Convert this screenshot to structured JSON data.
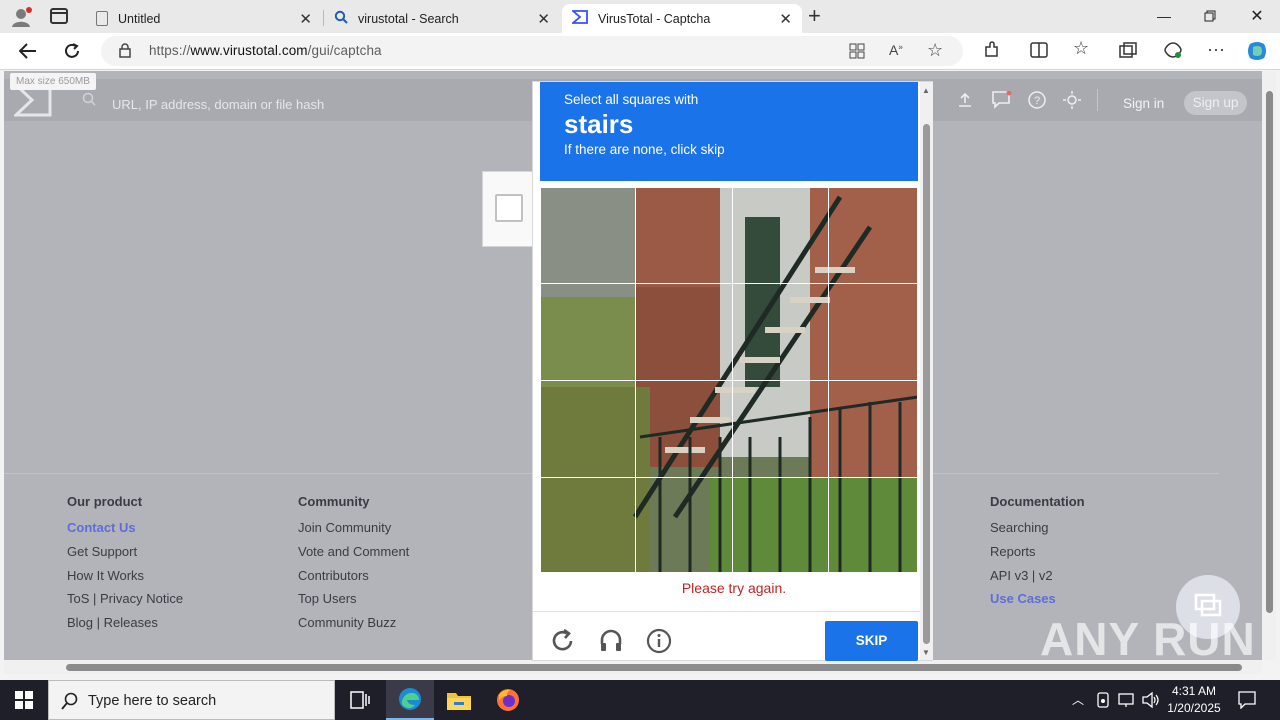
{
  "browser": {
    "tabs": [
      {
        "label": "Untitled",
        "active": false
      },
      {
        "label": "virustotal - Search",
        "active": false
      },
      {
        "label": "VirusTotal - Captcha",
        "active": true
      }
    ],
    "url_prefix": "https://",
    "url_domain": "www.virustotal.com",
    "url_path": "/gui/captcha"
  },
  "vt": {
    "max_size": "Max size 650MB",
    "search_placeholder": "URL, IP address, domain or file hash",
    "sign_in": "Sign in",
    "sign_up": "Sign up",
    "footer": {
      "col1": {
        "title": "Our product",
        "links": [
          "Contact Us",
          "Get Support",
          "How It Works",
          "ToS | Privacy Notice",
          "Blog | Releases"
        ]
      },
      "col2": {
        "title": "Community",
        "links": [
          "Join Community",
          "Vote and Comment",
          "Contributors",
          "Top Users",
          "Community Buzz"
        ]
      },
      "col5": {
        "title": "Documentation",
        "links": [
          "Searching",
          "Reports",
          "API v3 | v2",
          "Use Cases"
        ]
      }
    }
  },
  "captcha": {
    "line1": "Select all squares with",
    "keyword": "stairs",
    "line3": "If there are none, click skip",
    "error": "Please try again.",
    "skip_label": "SKIP",
    "grid_rows": 4,
    "grid_cols": 4,
    "icons": [
      "reload-icon",
      "audio-icon",
      "info-icon"
    ]
  },
  "watermark": "ANY RUN",
  "taskbar": {
    "search_placeholder": "Type here to search",
    "time": "4:31 AM",
    "date": "1/20/2025"
  },
  "colors": {
    "captcha_blue": "#1a73e8",
    "error_red": "#c5221f",
    "page_overlay": "#b3b4ba",
    "link_highlight": "#5e6dd8"
  }
}
